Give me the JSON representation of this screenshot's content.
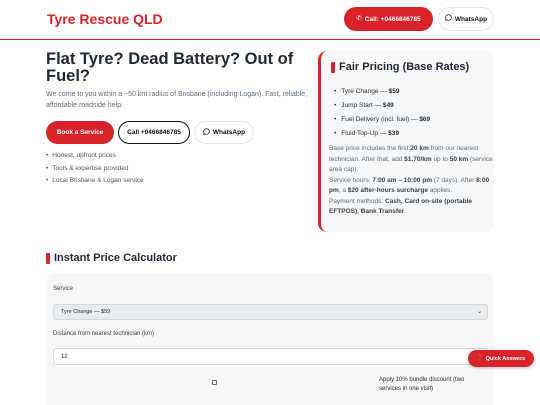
{
  "header": {
    "brand": "Tyre Rescue QLD",
    "call_label": "Call: +0466846785",
    "whatsapp_label": "WhatsApp"
  },
  "hero": {
    "title": "Flat Tyre? Dead Battery? Out of Fuel?",
    "subtitle": "We come to you within a ~50 km radius of Brisbane (including Logan). Fast, reliable, affordable roadside help.",
    "buttons": {
      "book": "Book a Service",
      "call": "Call +0466846785",
      "whatsapp": "WhatsApp"
    },
    "features": [
      "Honest, upfront prices",
      "Tools & expertise provided",
      "Local Brisbane & Logan service"
    ]
  },
  "pricing": {
    "title": "Fair Pricing (Base Rates)",
    "items": [
      {
        "name": "Tyre Change —",
        "price": "$59"
      },
      {
        "name": "Jump Start —",
        "price": "$49"
      },
      {
        "name": "Fuel Delivery (incl. fuel) —",
        "price": "$69"
      },
      {
        "name": "Fluid Top-Up —",
        "price": "$39"
      }
    ],
    "note": {
      "p1": "Base price includes the first ",
      "b1": "20 km",
      "p2": " from our nearest technician. After that, add ",
      "b2": "$1.70/km",
      "p3": " up to ",
      "b3": "50 km",
      "p4": " (service area cap).",
      "p5": "Service hours: ",
      "b5": "7:00 am – 10:00 pm",
      "p6": " (7 days). After ",
      "b6": "8:00 pm",
      "p7": ", a ",
      "b7": "$20 after-hours surcharge",
      "p8": " applies.",
      "p9": "Payment methods: ",
      "b9": "Cash, Card on-site (portable EFTPOS)",
      "p10": ", ",
      "b10": "Bank Transfer",
      "p11": "."
    }
  },
  "calculator": {
    "title": "Instant Price Calculator",
    "service_label": "Service",
    "service_value": "Tyre Change — $59",
    "distance_label": "Distance from nearest technician (km)",
    "distance_value": "12",
    "bundle_label": "Apply 10% bundle discount (two services in one visit)",
    "bundle_checked": false
  },
  "quick_answers": {
    "label": "Quick Answers"
  },
  "colors": {
    "accent": "#d8232a",
    "card_bg": "#f6f7f9",
    "text_dark": "#1f2933",
    "text_muted": "#5f6b7a"
  }
}
